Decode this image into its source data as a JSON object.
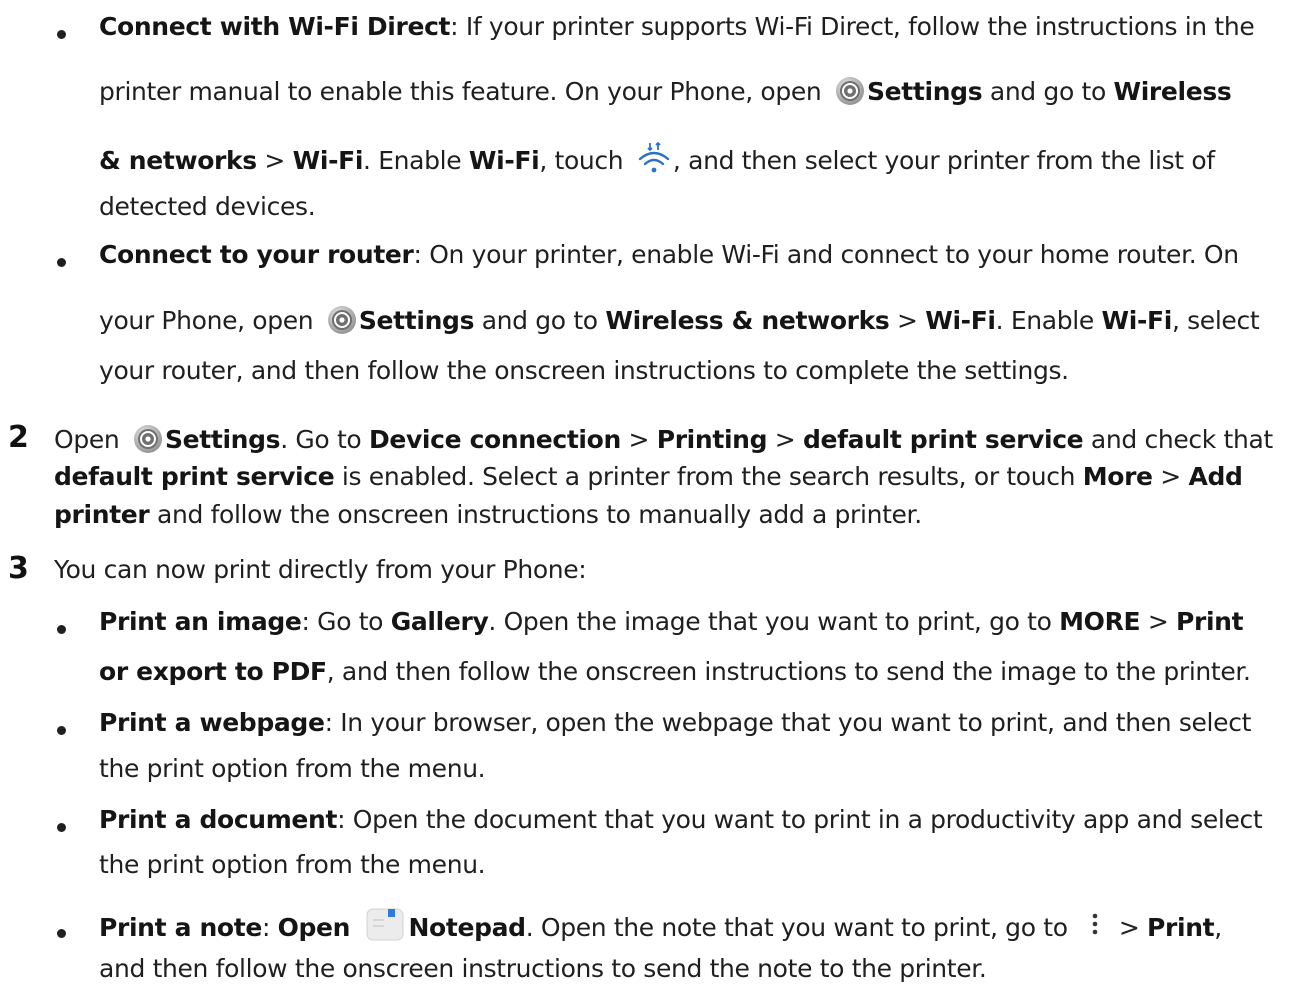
{
  "bullets_top": [
    {
      "lines": [
        [
          {
            "b": true,
            "t": "Connect with Wi-Fi Direct"
          },
          {
            "t": ": If your printer supports Wi-Fi Direct, follow the instructions in the"
          }
        ],
        [
          {
            "t": "printer manual to enable this feature. On your Phone, open "
          },
          {
            "icon": "settings-icon"
          },
          {
            "b": true,
            "t": "Settings"
          },
          {
            "t": " and go to "
          },
          {
            "b": true,
            "t": "Wireless"
          }
        ],
        [
          {
            "b": true,
            "t": "& networks"
          },
          {
            "t": " > "
          },
          {
            "b": true,
            "t": "Wi-Fi"
          },
          {
            "t": ". Enable "
          },
          {
            "b": true,
            "t": "Wi-Fi"
          },
          {
            "t": ", touch "
          },
          {
            "icon": "wifi-refresh-icon"
          },
          {
            "t": ", and then select your printer from the list of"
          }
        ],
        [
          {
            "t": "detected devices."
          }
        ]
      ]
    },
    {
      "lines": [
        [
          {
            "b": true,
            "t": "Connect to your router"
          },
          {
            "t": ": On your printer, enable Wi-Fi and connect to your home router. On"
          }
        ],
        [
          {
            "t": "your Phone, open "
          },
          {
            "icon": "settings-icon"
          },
          {
            "b": true,
            "t": "Settings"
          },
          {
            "t": " and go to "
          },
          {
            "b": true,
            "t": "Wireless & networks"
          },
          {
            "t": " > "
          },
          {
            "b": true,
            "t": "Wi-Fi"
          },
          {
            "t": ". Enable "
          },
          {
            "b": true,
            "t": "Wi-Fi"
          },
          {
            "t": ", select"
          }
        ],
        [
          {
            "t": "your router, and then follow the onscreen instructions to complete the settings."
          }
        ]
      ]
    }
  ],
  "step2": {
    "number": "2",
    "lines": [
      [
        {
          "t": "Open "
        },
        {
          "icon": "settings-icon"
        },
        {
          "b": true,
          "t": "Settings"
        },
        {
          "t": ". Go to "
        },
        {
          "b": true,
          "t": "Device connection"
        },
        {
          "t": " > "
        },
        {
          "b": true,
          "t": "Printing"
        },
        {
          "t": " > "
        },
        {
          "b": true,
          "t": "default print service"
        },
        {
          "t": " and check that"
        }
      ],
      [
        {
          "b": true,
          "t": "default print service"
        },
        {
          "t": " is enabled. Select a printer from the search results, or touch "
        },
        {
          "b": true,
          "t": "More"
        },
        {
          "t": " > "
        },
        {
          "b": true,
          "t": "Add"
        }
      ],
      [
        {
          "b": true,
          "t": "printer"
        },
        {
          "t": " and follow the onscreen instructions to manually add a printer."
        }
      ]
    ]
  },
  "step3": {
    "number": "3",
    "lines": [
      [
        {
          "t": "You can now print directly from your Phone:"
        }
      ]
    ]
  },
  "bullets_bottom": [
    {
      "lines": [
        [
          {
            "b": true,
            "t": "Print an image"
          },
          {
            "t": ": Go to "
          },
          {
            "b": true,
            "t": "Gallery"
          },
          {
            "t": ". Open the image that you want to print, go to "
          },
          {
            "b": true,
            "t": "MORE"
          },
          {
            "t": " > "
          },
          {
            "b": true,
            "t": "Print"
          }
        ],
        [
          {
            "b": true,
            "t": "or export to PDF"
          },
          {
            "t": ", and then follow the onscreen instructions to send the image to the printer."
          }
        ]
      ]
    },
    {
      "lines": [
        [
          {
            "b": true,
            "t": "Print a webpage"
          },
          {
            "t": ": In your browser, open the webpage that you want to print, and then select"
          }
        ],
        [
          {
            "t": "the print option from the menu."
          }
        ]
      ]
    },
    {
      "lines": [
        [
          {
            "b": true,
            "t": "Print a document"
          },
          {
            "t": ": Open the document that you want to print in a productivity app and select"
          }
        ],
        [
          {
            "t": "the print option from the menu."
          }
        ]
      ]
    },
    {
      "lines": [
        [
          {
            "b": true,
            "t": "Print a note"
          },
          {
            "t": ": "
          },
          {
            "b": true,
            "t": "Open "
          },
          {
            "icon": "notepad-icon"
          },
          {
            "b": true,
            "t": "Notepad"
          },
          {
            "t": ". Open the note that you want to print, go to "
          },
          {
            "icon": "more-vertical-icon"
          },
          {
            "t": " > "
          },
          {
            "b": true,
            "t": "Print"
          },
          {
            "t": ","
          }
        ],
        [
          {
            "t": "and then follow the onscreen instructions to send the note to the printer."
          }
        ]
      ]
    }
  ]
}
